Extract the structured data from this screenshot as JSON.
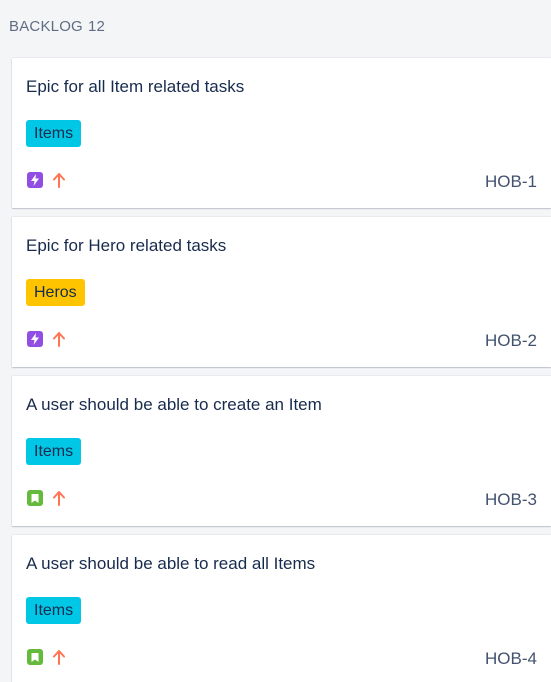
{
  "column": {
    "title": "BACKLOG",
    "count": "12"
  },
  "colors": {
    "items_label": "#00c7e6",
    "heros_label": "#ffc400",
    "epic_icon": "#904ee2",
    "story_icon": "#63ba3c",
    "priority_high": "#ff7452"
  },
  "cards": [
    {
      "summary": "Epic for all Item related tasks",
      "label": "Items",
      "issue_type_icon": "epic-lightning-icon",
      "priority_icon": "priority-arrow-up-icon",
      "key": "HOB-1"
    },
    {
      "summary": "Epic for Hero related tasks",
      "label": "Heros",
      "issue_type_icon": "epic-lightning-icon",
      "priority_icon": "priority-arrow-up-icon",
      "key": "HOB-2"
    },
    {
      "summary": "A user should be able to create an Item",
      "label": "Items",
      "issue_type_icon": "story-bookmark-icon",
      "priority_icon": "priority-arrow-up-icon",
      "key": "HOB-3"
    },
    {
      "summary": "A user should be able to read all Items",
      "label": "Items",
      "issue_type_icon": "story-bookmark-icon",
      "priority_icon": "priority-arrow-up-icon",
      "key": "HOB-4"
    }
  ]
}
